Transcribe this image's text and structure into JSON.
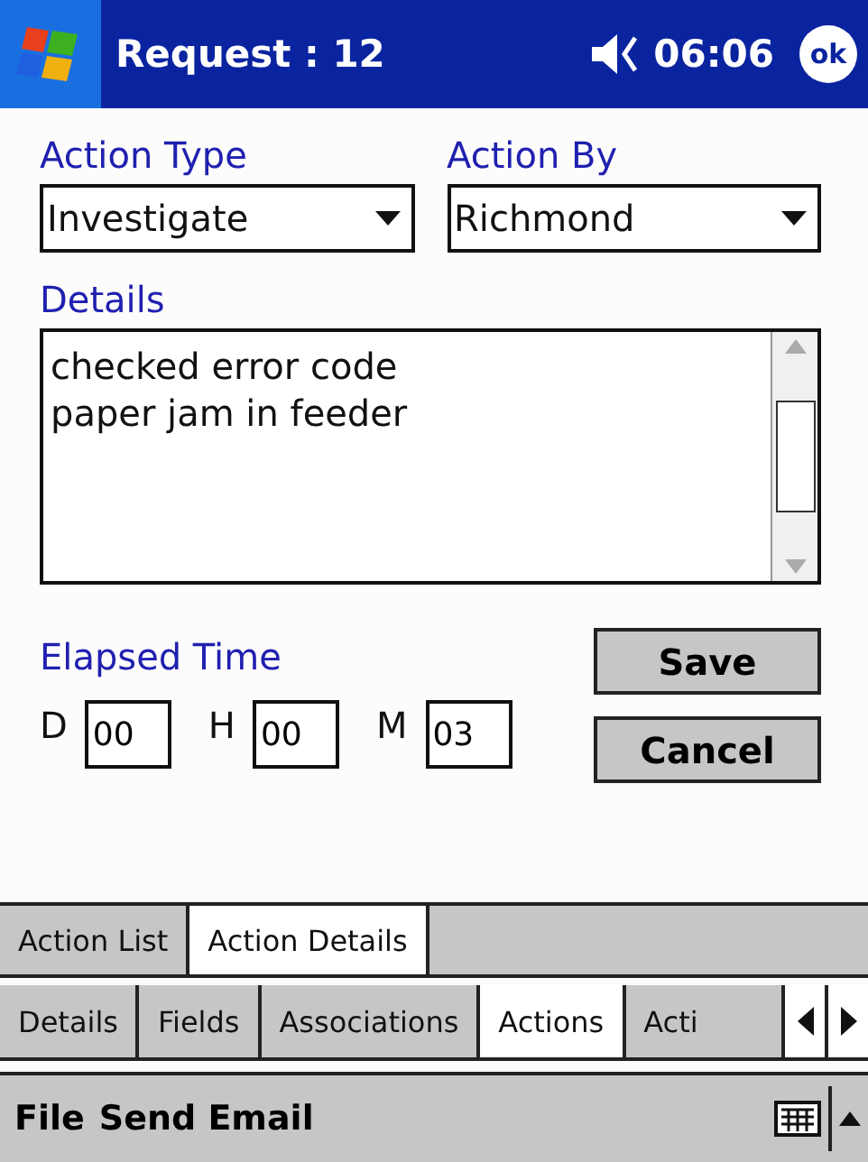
{
  "title_bar": {
    "title": "Request : 12",
    "time": "06:06",
    "ok": "ok"
  },
  "action_type": {
    "label": "Action Type",
    "value": "Investigate"
  },
  "action_by": {
    "label": "Action By",
    "value": "Richmond"
  },
  "details": {
    "label": "Details",
    "lines": [
      "checked error code",
      "paper jam in feeder"
    ]
  },
  "elapsed": {
    "label": "Elapsed Time",
    "fields": [
      {
        "unit": "D",
        "value": "00"
      },
      {
        "unit": "H",
        "value": "00"
      },
      {
        "unit": "M",
        "value": "03"
      }
    ]
  },
  "buttons": [
    "Save",
    "Cancel"
  ],
  "tabs": [
    {
      "label": "Action List",
      "selected": false
    },
    {
      "label": "Action Details",
      "selected": true
    }
  ],
  "subtabs": [
    {
      "label": "Details",
      "selected": false
    },
    {
      "label": "Fields",
      "selected": false
    },
    {
      "label": "Associations",
      "selected": false
    },
    {
      "label": "Actions",
      "selected": true
    },
    {
      "label": "Acti",
      "selected": false
    }
  ],
  "menu": [
    "File",
    "Send Email"
  ]
}
